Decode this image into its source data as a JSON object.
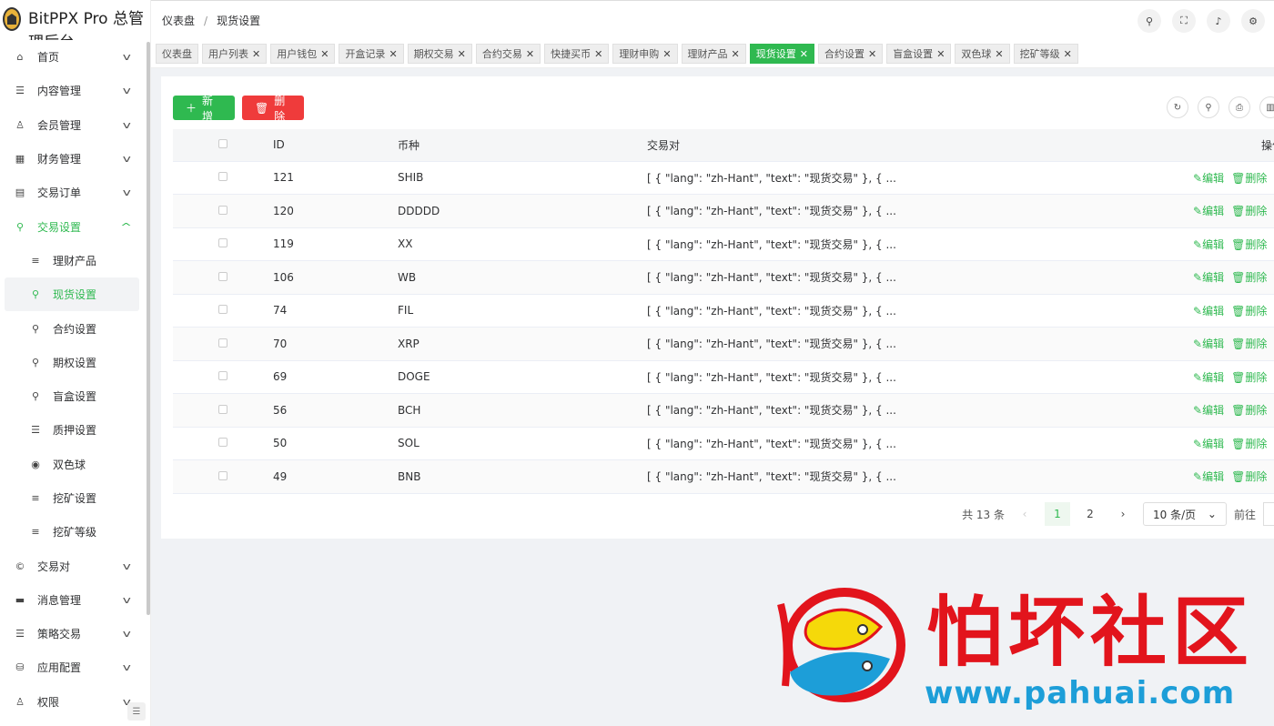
{
  "brand": {
    "title": "BitPPX Pro 总管理后台"
  },
  "sidebar": {
    "items": [
      {
        "label": "首页",
        "icon": "⌂"
      },
      {
        "label": "内容管理",
        "icon": "☰"
      },
      {
        "label": "会员管理",
        "icon": "♙"
      },
      {
        "label": "财务管理",
        "icon": "▦"
      },
      {
        "label": "交易订单",
        "icon": "▤"
      },
      {
        "label": "交易设置",
        "icon": "⚲"
      }
    ],
    "sub_items": [
      {
        "label": "理财产品",
        "icon": "≡"
      },
      {
        "label": "现货设置",
        "icon": "⚲"
      },
      {
        "label": "合约设置",
        "icon": "⚲"
      },
      {
        "label": "期权设置",
        "icon": "⚲"
      },
      {
        "label": "盲盒设置",
        "icon": "⚲"
      },
      {
        "label": "质押设置",
        "icon": "☰"
      },
      {
        "label": "双色球",
        "icon": "◉"
      },
      {
        "label": "挖矿设置",
        "icon": "≡"
      },
      {
        "label": "挖矿等级",
        "icon": "≡"
      }
    ],
    "bottom_items": [
      {
        "label": "交易对",
        "icon": "©"
      },
      {
        "label": "消息管理",
        "icon": "▬"
      },
      {
        "label": "策略交易",
        "icon": "☰"
      },
      {
        "label": "应用配置",
        "icon": "⛁"
      },
      {
        "label": "权限",
        "icon": "♙"
      }
    ]
  },
  "header": {
    "breadcrumb": [
      "仪表盘",
      "现货设置"
    ]
  },
  "tabs": [
    "仪表盘",
    "用户列表",
    "用户钱包",
    "开盒记录",
    "期权交易",
    "合约交易",
    "快捷买币",
    "理财申购",
    "理财产品",
    "现货设置",
    "合约设置",
    "盲盒设置",
    "双色球",
    "挖矿等级"
  ],
  "active_tab": "现货设置",
  "toolbar": {
    "add_label": "新增",
    "delete_label": "删除"
  },
  "table": {
    "columns": [
      "ID",
      "币种",
      "交易对",
      "操作"
    ],
    "rows": [
      {
        "id": "121",
        "coin": "SHIB",
        "pair": "[ { \"lang\": \"zh-Hant\", \"text\": \"现货交易\" }, { ..."
      },
      {
        "id": "120",
        "coin": "DDDDD",
        "pair": "[ { \"lang\": \"zh-Hant\", \"text\": \"现货交易\" }, { ..."
      },
      {
        "id": "119",
        "coin": "XX",
        "pair": "[ { \"lang\": \"zh-Hant\", \"text\": \"现货交易\" }, { ..."
      },
      {
        "id": "106",
        "coin": "WB",
        "pair": "[ { \"lang\": \"zh-Hant\", \"text\": \"现货交易\" }, { ..."
      },
      {
        "id": "74",
        "coin": "FIL",
        "pair": "[ { \"lang\": \"zh-Hant\", \"text\": \"现货交易\" }, { ..."
      },
      {
        "id": "70",
        "coin": "XRP",
        "pair": "[ { \"lang\": \"zh-Hant\", \"text\": \"现货交易\" }, { ..."
      },
      {
        "id": "69",
        "coin": "DOGE",
        "pair": "[ { \"lang\": \"zh-Hant\", \"text\": \"现货交易\" }, { ..."
      },
      {
        "id": "56",
        "coin": "BCH",
        "pair": "[ { \"lang\": \"zh-Hant\", \"text\": \"现货交易\" }, { ..."
      },
      {
        "id": "50",
        "coin": "SOL",
        "pair": "[ { \"lang\": \"zh-Hant\", \"text\": \"现货交易\" }, { ..."
      },
      {
        "id": "49",
        "coin": "BNB",
        "pair": "[ { \"lang\": \"zh-Hant\", \"text\": \"现货交易\" }, { ..."
      }
    ],
    "edit_label": "编辑",
    "delete_label": "删除"
  },
  "pagination": {
    "total_text": "共 13 条",
    "pages": [
      "1",
      "2"
    ],
    "current_page": "1",
    "page_size": "10 条/页",
    "jump_label": "前往"
  },
  "watermark": {
    "cn": "怕坏社区",
    "url": "www.pahuai.com"
  },
  "colors": {
    "accent": "#2fb950",
    "danger": "#ef3b3b"
  }
}
